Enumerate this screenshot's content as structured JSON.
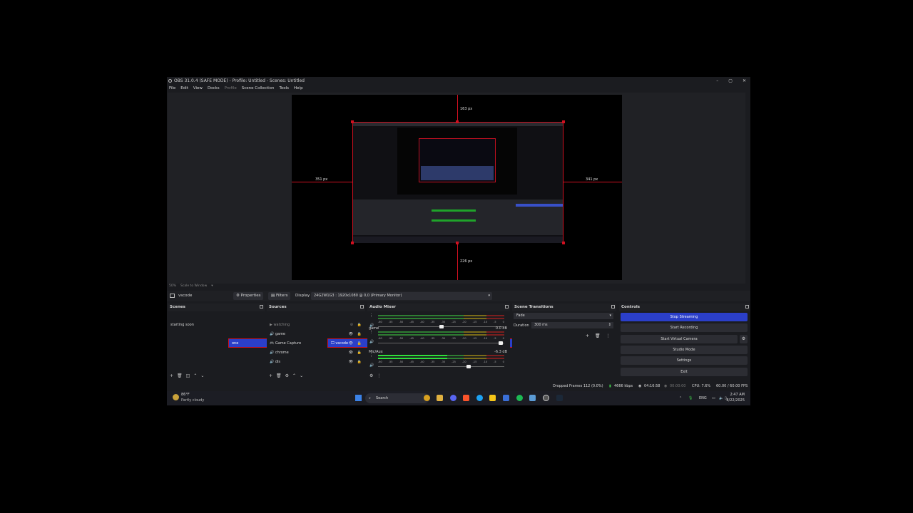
{
  "window": {
    "title": "OBS 31.0.4 (SAFE MODE) - Profile: Untitled - Scenes: Untitled",
    "min": "–",
    "max": "▢",
    "close": "✕"
  },
  "menu": [
    "File",
    "Edit",
    "View",
    "Docks",
    "Profile",
    "Scene Collection",
    "Tools",
    "Help"
  ],
  "preview": {
    "top_px": "163 px",
    "left_px": "351 px",
    "right_px": "341 px",
    "bottom_px": "226 px",
    "zoom": "50%",
    "scale_mode": "Scale to Window"
  },
  "context": {
    "source_name": "vscode",
    "properties": "Properties",
    "filters": "Filters",
    "display_label": "Display",
    "display_value": "24G2W1G3 : 1920x1080 @ 0,0 (Primary Monitor)"
  },
  "scenes": {
    "title": "Scenes",
    "items": [
      "one",
      "starting soon"
    ]
  },
  "sources": {
    "title": "Sources",
    "items": [
      {
        "icon": "🖵",
        "label": "vscode"
      },
      {
        "icon": "▶",
        "label": "watching"
      },
      {
        "icon": "🔊",
        "label": "game"
      },
      {
        "icon": "🎮",
        "label": "Game Capture"
      },
      {
        "icon": "🔊",
        "label": "chrome"
      },
      {
        "icon": "🔊",
        "label": "dis"
      }
    ]
  },
  "mixer": {
    "title": "Audio Mixer",
    "ticks": [
      "-60",
      "-55",
      "-50",
      "-45",
      "-40",
      "-35",
      "-30",
      "-25",
      "-20",
      "-15",
      "-10",
      "-5",
      "0"
    ],
    "channels": [
      {
        "name": "",
        "db": "",
        "level": 0,
        "fader": 0.5
      },
      {
        "name": "game",
        "db": "0.0 dB",
        "level": 0,
        "fader": 0.97
      },
      {
        "name": "Mic/Aux",
        "db": "-6.3 dB",
        "level": 0.55,
        "fader": 0.72
      }
    ]
  },
  "transitions": {
    "title": "Scene Transitions",
    "selected": "Fade",
    "duration_label": "Duration",
    "duration_value": "300 ms"
  },
  "controls": {
    "title": "Controls",
    "buttons": [
      "Stop Streaming",
      "Start Recording",
      "Start Virtual Camera",
      "Studio Mode",
      "Settings",
      "Exit"
    ]
  },
  "status": {
    "dropped": "Dropped Frames 112 (0.0%)",
    "bitrate": "4666 kbps",
    "stream_time": "04:16:58",
    "rec_time": "00:00:00",
    "cpu": "CPU: 7.6%",
    "fps": "60.00 / 60.00 FPS"
  },
  "taskbar": {
    "weather_temp": "86°F",
    "weather_desc": "Partly cloudy",
    "search": "Search",
    "lang": "ENG",
    "time": "2:47 AM",
    "date": "8/22/2025"
  },
  "colors": {
    "accent": "#2b3fc9",
    "guide_red": "#d01020",
    "bg": "#1b1c20"
  }
}
